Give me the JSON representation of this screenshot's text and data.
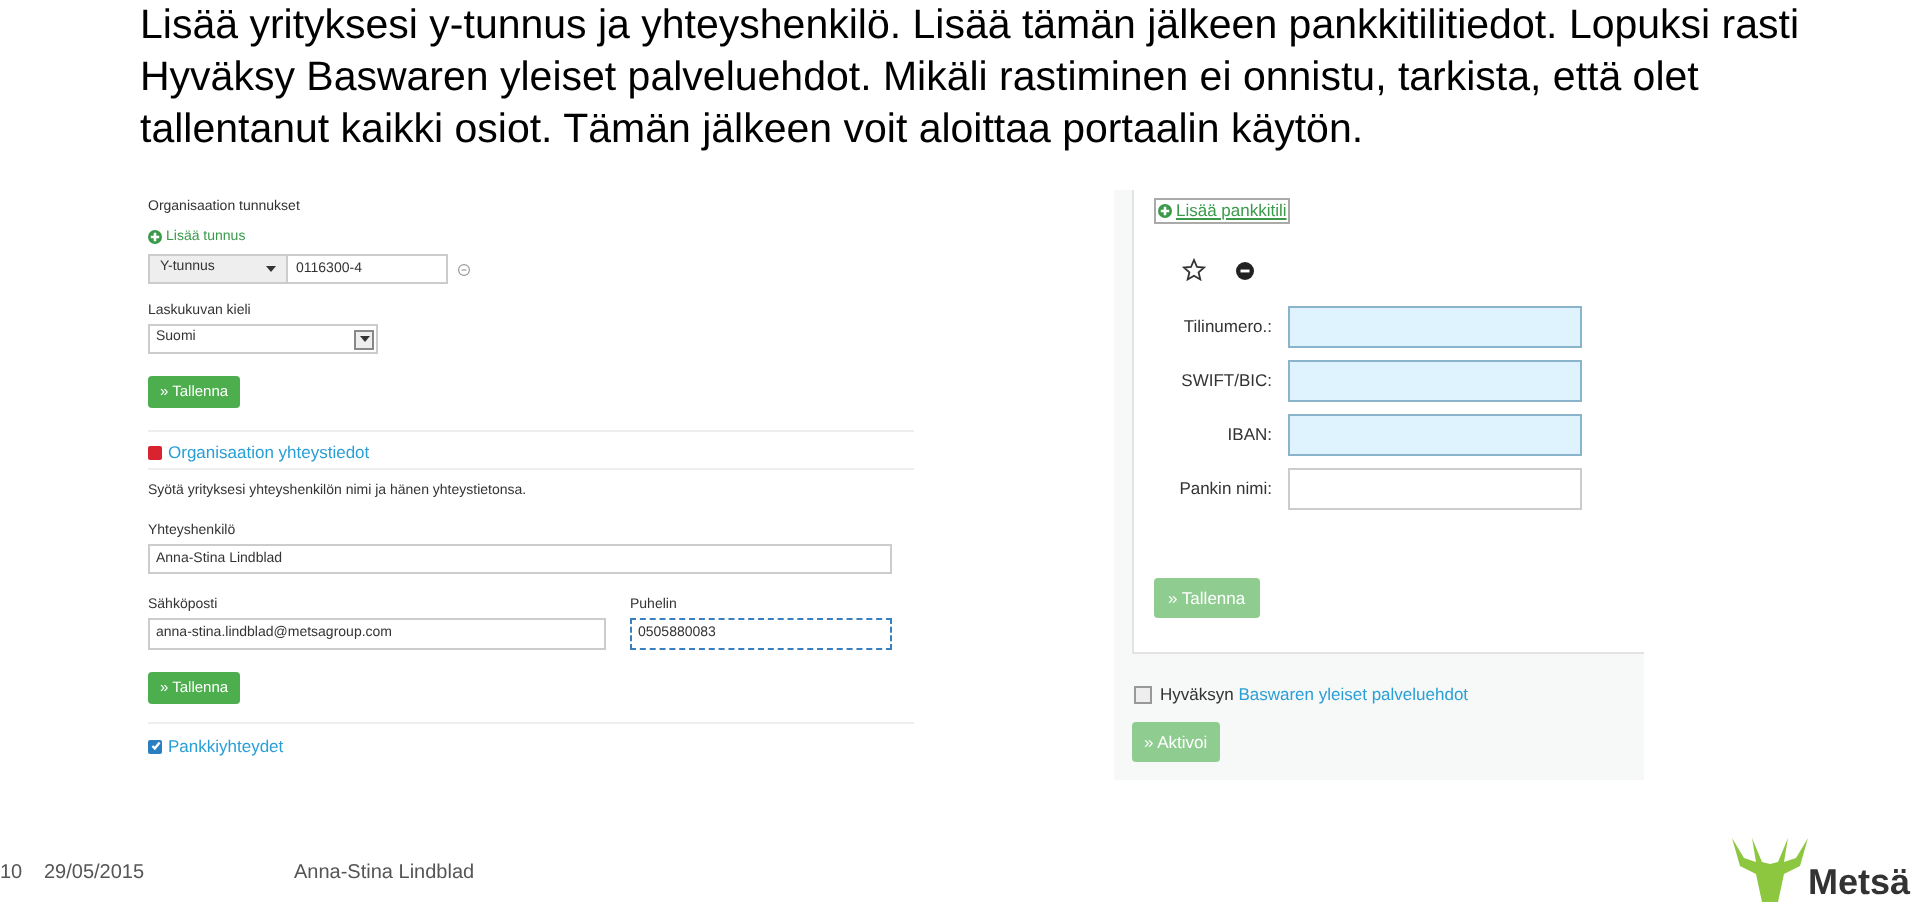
{
  "instructions": "Lisää yrityksesi y-tunnus ja yhteyshenkilö. Lisää tämän jälkeen pankkitilitiedot. Lopuksi rasti Hyväksy Baswaren yleiset palveluehdot. Mikäli rastiminen ei onnistu, tarkista, että olet tallentanut kaikki osiot. Tämän jälkeen voit aloittaa portaalin käytön.",
  "left_panel": {
    "section_title": "Organisaation tunnukset",
    "add_link": "Lisää tunnus",
    "id_type": "Y-tunnus",
    "id_value": "0116300-4",
    "language_label": "Laskukuvan kieli",
    "language": "Suomi",
    "save_1": {
      "label": "» Tallenna",
      "disabled": false
    },
    "contact_section": {
      "title": "Organisaation yhteystiedot",
      "expanded": true
    },
    "description": "Syötä yrityksesi yhteyshenkilön nimi ja hänen yhteystietonsa.",
    "fields": [
      {
        "label": "Yhteyshenkilö",
        "value": "Anna-Stina Lindblad",
        "focused": false
      },
      {
        "label": "Sähköposti",
        "value": "anna-stina.lindblad@metsagroup.com",
        "focused": false
      },
      {
        "label": "Puhelin",
        "value": "0505880083",
        "focused": true
      }
    ],
    "save_2": {
      "label": "» Tallenna",
      "disabled": false
    },
    "bank_section": {
      "title": "Pankkiyhteydet",
      "checked": true
    }
  },
  "right_panel": {
    "add_link": "Lisää pankkitili",
    "fields": [
      {
        "label": "Tilinumero.:",
        "highlighted": true
      },
      {
        "label": "SWIFT/BIC:",
        "highlighted": true
      },
      {
        "label": "IBAN:",
        "highlighted": true
      },
      {
        "label": "Pankin nimi:",
        "highlighted": false
      }
    ],
    "save": {
      "label": "» Tallenna",
      "disabled": true
    },
    "terms": {
      "checked": false,
      "text": "Hyväksyn",
      "link": "Baswaren yleiset palveluehdot"
    },
    "activate": {
      "label": "» Aktivoi",
      "disabled": true
    }
  },
  "footer": {
    "page": "10",
    "date": "29/05/2015",
    "author": "Anna-Stina Lindblad",
    "logo": "Metsä"
  }
}
